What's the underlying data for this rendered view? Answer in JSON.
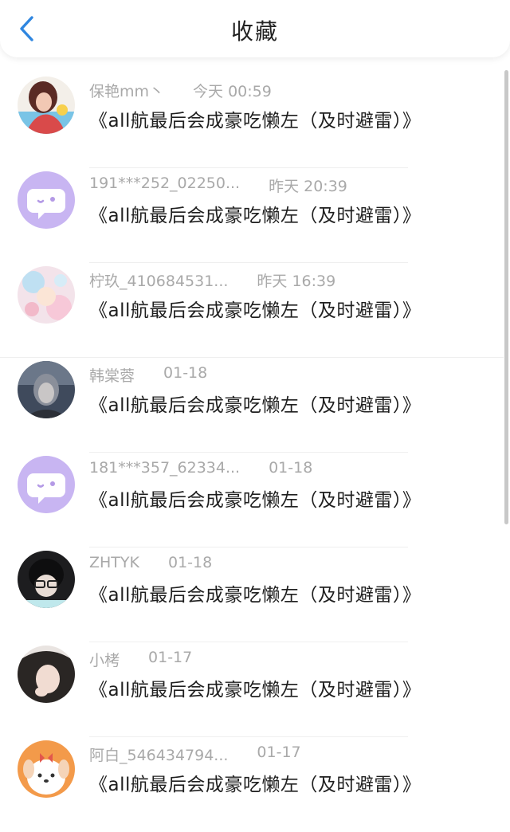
{
  "header": {
    "title": "收藏",
    "back_icon": "chevron-left-icon",
    "accent_color": "#2f86e0"
  },
  "items": [
    {
      "name": "保艳mm丶",
      "time": "今天 00:59",
      "content": "《all航最后会成豪吃懒左（及时避雷）》",
      "avatar": "photo-avatar"
    },
    {
      "name": "191***252_02250...",
      "time": "昨天 20:39",
      "content": "《all航最后会成豪吃懒左（及时避雷）》",
      "avatar": "default-chat-avatar"
    },
    {
      "name": "柠玖_410684531...",
      "time": "昨天 16:39",
      "content": "《all航最后会成豪吃懒左（及时避雷）》",
      "avatar": "photo-avatar"
    },
    {
      "name": "韩棠蓉",
      "time": "01-18",
      "content": "《all航最后会成豪吃懒左（及时避雷）》",
      "avatar": "photo-avatar"
    },
    {
      "name": "181***357_62334...",
      "time": "01-18",
      "content": "《all航最后会成豪吃懒左（及时避雷）》",
      "avatar": "default-chat-avatar"
    },
    {
      "name": "ZHTYK",
      "time": "01-18",
      "content": "《all航最后会成豪吃懒左（及时避雷）》",
      "avatar": "photo-avatar"
    },
    {
      "name": "小栲",
      "time": "01-17",
      "content": "《all航最后会成豪吃懒左（及时避雷）》",
      "avatar": "photo-avatar"
    },
    {
      "name": "阿白_546434794...",
      "time": "01-17",
      "content": "《all航最后会成豪吃懒左（及时避雷）》",
      "avatar": "cartoon-dog-avatar"
    }
  ]
}
